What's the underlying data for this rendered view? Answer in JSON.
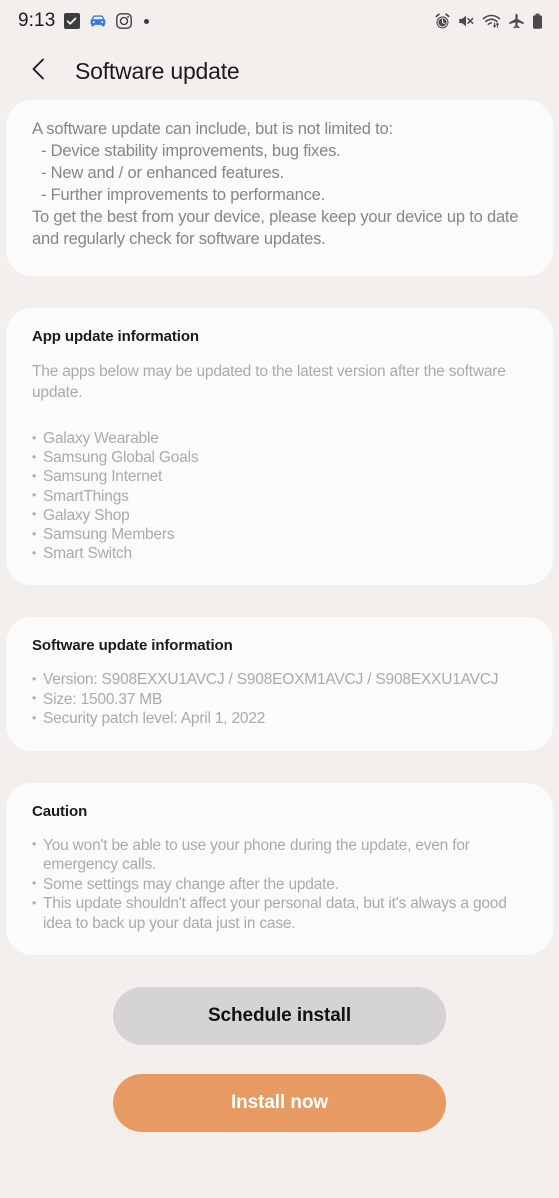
{
  "status_bar": {
    "time": "9:13",
    "left_icons": [
      {
        "name": "checkbox-filled-icon",
        "label": "task-complete"
      },
      {
        "name": "car-icon",
        "label": "driving-mode"
      },
      {
        "name": "instagram-icon",
        "label": "instagram"
      },
      {
        "name": "more-dot-icon",
        "label": "more-notifications"
      }
    ],
    "right_icons": [
      {
        "name": "alarm-icon",
        "label": "alarm-set"
      },
      {
        "name": "mute-icon",
        "label": "sound-muted"
      },
      {
        "name": "wifi-icon",
        "label": "wifi-connected"
      },
      {
        "name": "airplane-icon",
        "label": "airplane-mode"
      },
      {
        "name": "battery-icon",
        "label": "battery-full"
      }
    ]
  },
  "header": {
    "back_label": "Back",
    "title": "Software update"
  },
  "intro_card": {
    "lines": [
      "A software update can include, but is not limited to:",
      "- Device stability improvements, bug fixes.",
      "- New and / or enhanced features.",
      "- Further improvements to performance.",
      "To get the best from your device, please keep your device up to date and regularly check for software updates."
    ],
    "line1": "A software update can include, but is not limited to:",
    "line2": "- Device stability improvements, bug fixes.",
    "line3": "- New and / or enhanced features.",
    "line4": "- Further improvements to performance.",
    "line5": "To get the best from your device, please keep your device up to date and regularly check for software updates."
  },
  "app_update_card": {
    "title": "App update information",
    "description": "The apps below may be updated to the latest version after the software update.",
    "apps": [
      "Galaxy Wearable",
      "Samsung Global Goals",
      "Samsung Internet",
      "SmartThings",
      "Galaxy Shop",
      "Samsung Members",
      "Smart Switch"
    ]
  },
  "software_info_card": {
    "title": "Software update information",
    "items": [
      "Version: S908EXXU1AVCJ / S908EOXM1AVCJ / S908EXXU1AVCJ",
      "Size: 1500.37 MB",
      "Security patch level: April 1, 2022"
    ],
    "version": "Version: S908EXXU1AVCJ / S908EOXM1AVCJ / S908EXXU1AVCJ",
    "size": "Size: 1500.37 MB",
    "security_patch": "Security patch level: April 1, 2022"
  },
  "caution_card": {
    "title": "Caution",
    "items": [
      "You won't be able to use your phone during the update, even for emergency calls.",
      "Some settings may change after the update.",
      "This update shouldn't affect your personal data, but it's always a good idea to back up your data just in case."
    ]
  },
  "actions": {
    "schedule_label": "Schedule install",
    "install_label": "Install now"
  },
  "colors": {
    "page_background": "#F3EFED",
    "card_background": "#FCFBFB",
    "primary_button": "#E89A63",
    "secondary_button": "#D6D4D2",
    "title_text": "#1B1B1B",
    "body_text": "#ACAAA9",
    "intro_text": "#888584"
  }
}
